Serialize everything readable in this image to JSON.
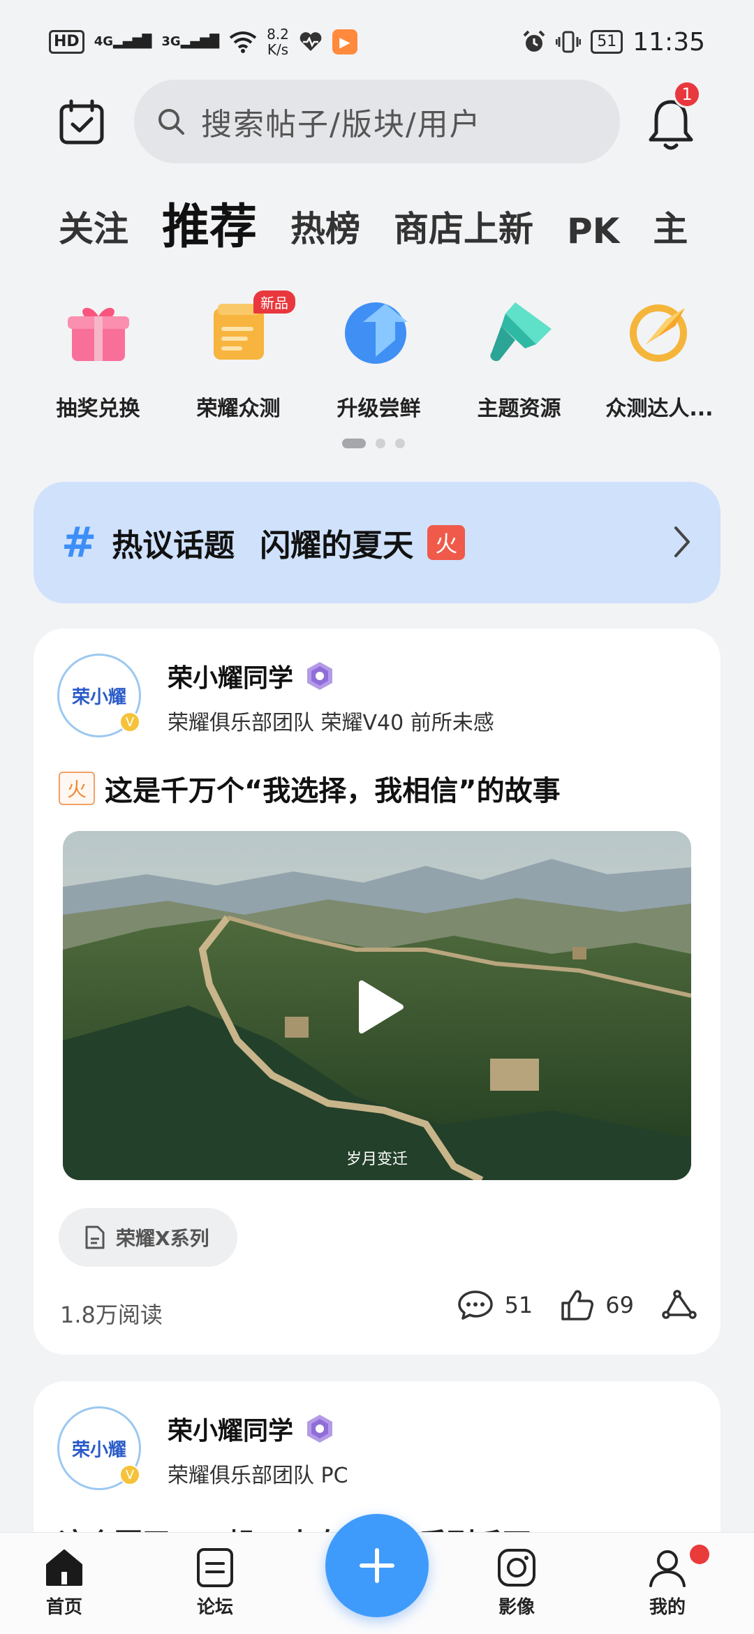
{
  "status_bar": {
    "hd": "HD",
    "sim1": "4G",
    "sim2": "3G",
    "speed_value": "8.2",
    "speed_unit": "K/s",
    "battery": "51",
    "time": "11:35"
  },
  "header": {
    "search_placeholder": "搜索帖子/版块/用户",
    "notification_count": "1"
  },
  "tabs": [
    {
      "label": "关注"
    },
    {
      "label": "推荐",
      "active": true
    },
    {
      "label": "热榜"
    },
    {
      "label": "商店上新"
    },
    {
      "label": "PK"
    },
    {
      "label": "主"
    }
  ],
  "shortcuts": [
    {
      "label": "抽奖兑换",
      "icon": "gift-icon"
    },
    {
      "label": "荣耀众测",
      "icon": "notepad-icon",
      "badge": "新品"
    },
    {
      "label": "升级尝鲜",
      "icon": "upgrade-arrow-icon"
    },
    {
      "label": "主题资源",
      "icon": "paint-brush-icon"
    },
    {
      "label": "众测达人...",
      "icon": "rocket-badge-icon"
    }
  ],
  "topic": {
    "label": "热议话题",
    "title": "闪耀的夏天",
    "badge": "火"
  },
  "posts": [
    {
      "avatar_text": "荣小耀",
      "author": "荣小耀同学",
      "meta": "荣耀俱乐部团队  荣耀V40 前所未感",
      "hot_tag": "火",
      "title": "这是千万个“我选择，我相信”的故事",
      "caption": "岁月变迁",
      "tag": "荣耀X系列",
      "reads": "1.8万阅读",
      "comments": "51",
      "likes": "69"
    },
    {
      "avatar_text": "荣小耀",
      "author": "荣小耀同学",
      "meta": "荣耀俱乐部团队  PC",
      "title": "这个夏天，一起...来自荣耀X系列千万..."
    }
  ],
  "bottom_nav": [
    {
      "label": "首页",
      "icon": "home-icon"
    },
    {
      "label": "论坛",
      "icon": "forum-icon"
    },
    {
      "label": "影像",
      "icon": "camera-icon"
    },
    {
      "label": "我的",
      "icon": "profile-icon"
    }
  ],
  "colors": {
    "accent": "#3f9bfb",
    "topic_bg": "#cfe1fb",
    "badge_red": "#e8383d"
  }
}
